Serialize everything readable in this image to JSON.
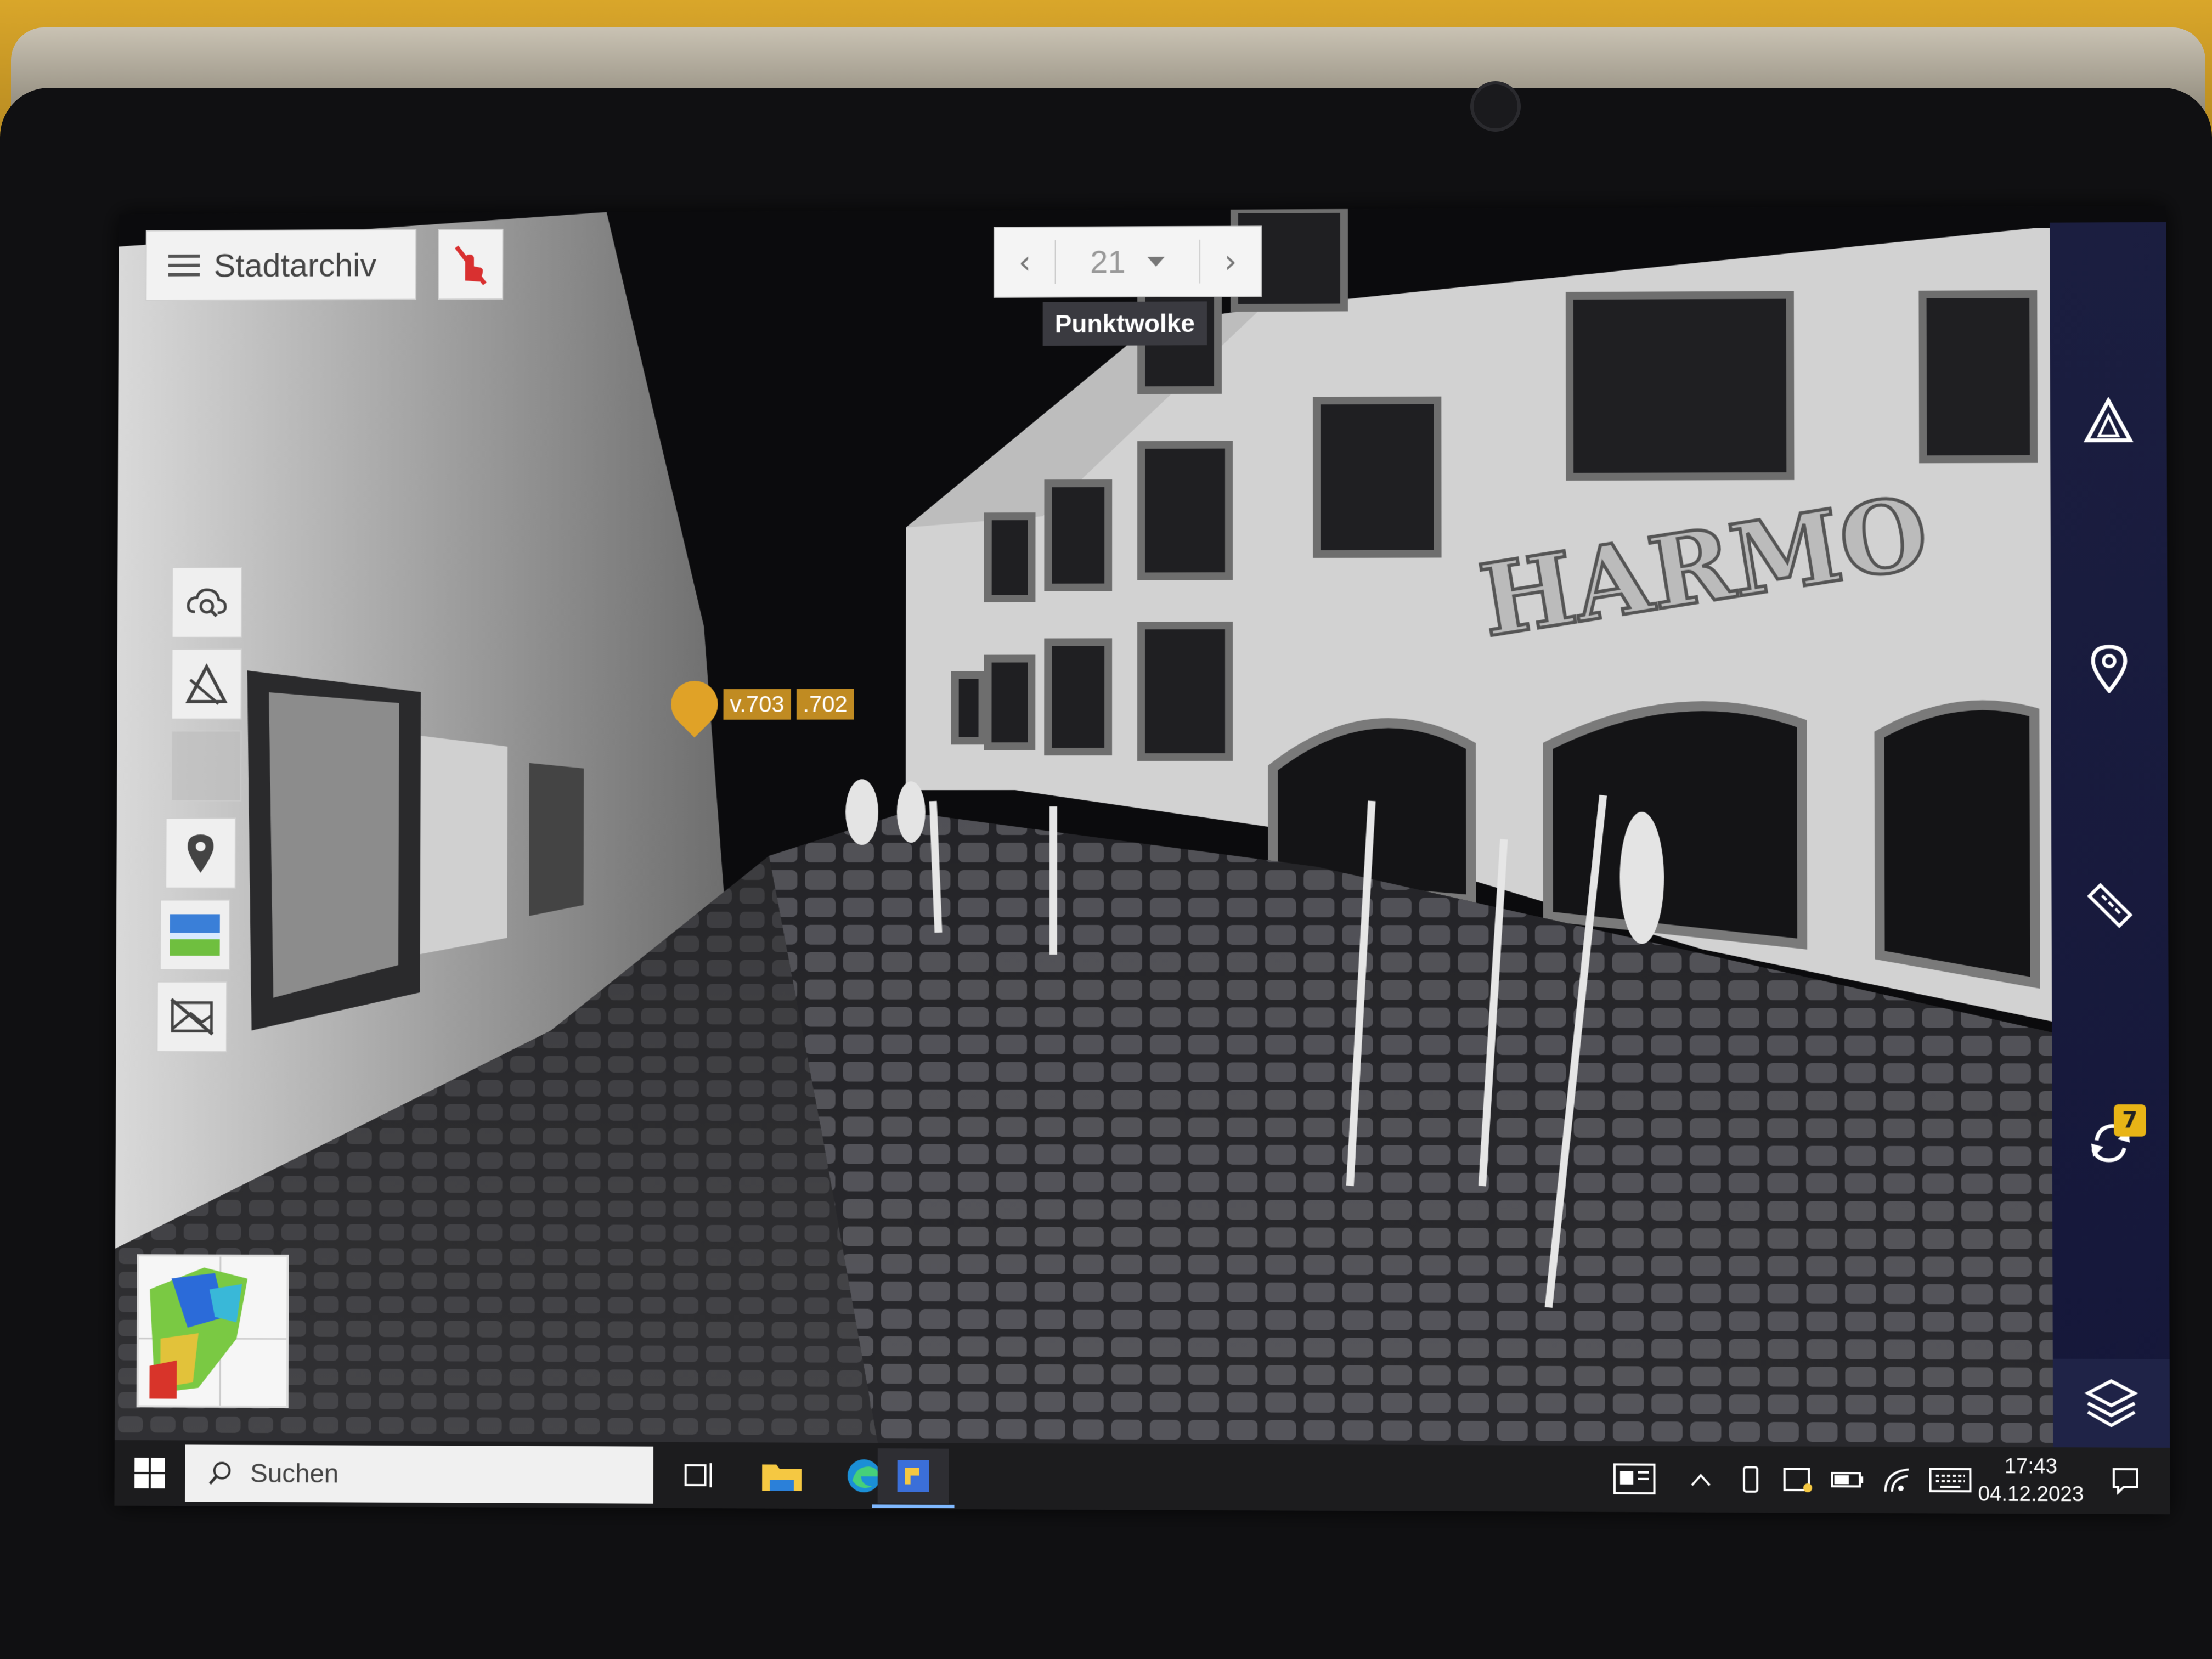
{
  "app": {
    "project_menu_label": "Stadtarchiv",
    "view_mode_tooltip": "Punktwolke"
  },
  "scan_navigator": {
    "current_scan": "21",
    "prev_icon": "chevron-left-icon",
    "next_icon": "chevron-right-icon"
  },
  "markers": [
    {
      "label": "v.703"
    },
    {
      "label": ".702"
    }
  ],
  "left_tools": [
    {
      "icon": "cloud-search-icon"
    },
    {
      "icon": "measure-triangle-icon"
    },
    {
      "icon": "image-overlay-icon"
    },
    {
      "icon": "map-pin-icon"
    },
    {
      "icon": "landscape-photo-icon"
    },
    {
      "icon": "hide-overlay-icon"
    }
  ],
  "right_toolbar": [
    {
      "icon": "annotation-triangle-icon"
    },
    {
      "icon": "location-pin-icon"
    },
    {
      "icon": "ruler-icon"
    },
    {
      "icon": "sync-icon",
      "badge": "7"
    },
    {
      "icon": "layers-icon"
    }
  ],
  "taskbar": {
    "search_placeholder": "Suchen",
    "time": "17:43",
    "date": "04.12.2023"
  },
  "scene_text": {
    "facade_lettering": "HARMO"
  },
  "colors": {
    "toolbar_bg": "#1b1e40",
    "marker_accent": "#e0a227",
    "badge": "#e8b416",
    "alert_red": "#d93030"
  }
}
